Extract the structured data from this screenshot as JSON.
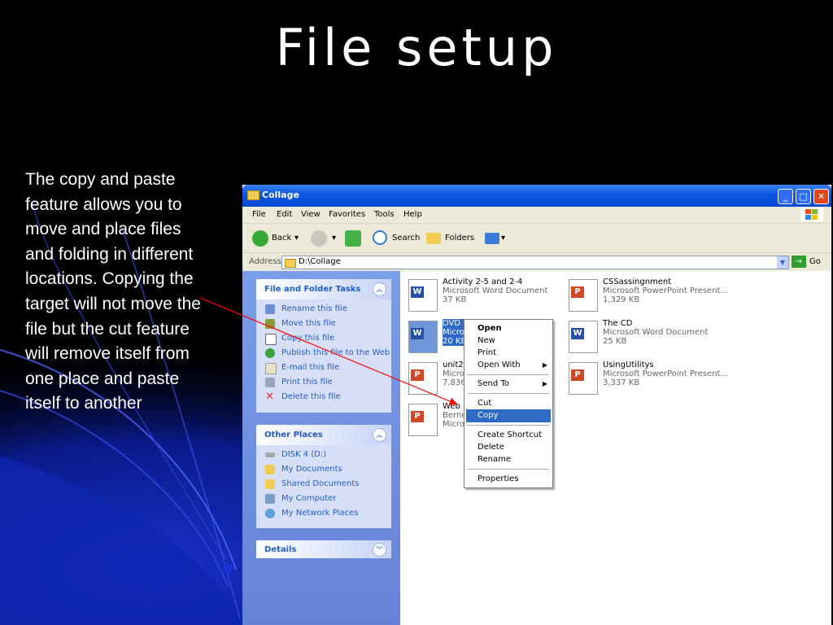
{
  "slide": {
    "title": "File setup",
    "body": "The copy and paste feature allows you to move and place files and folding in different locations. Copying the target will not move the file but the cut feature will remove itself from one place and paste itself to another"
  },
  "window": {
    "title": "Collage",
    "minimize": "_",
    "maximize": "□",
    "close": "✕"
  },
  "menu": [
    "File",
    "Edit",
    "View",
    "Favorites",
    "Tools",
    "Help"
  ],
  "toolbar": {
    "back": "Back",
    "back_drop": "▾",
    "fwd_drop": "▾",
    "search": "Search",
    "folders": "Folders",
    "views_drop": "▾"
  },
  "address": {
    "label": "Address",
    "value": "D:\\Collage",
    "go": "Go",
    "go_arrow": "→",
    "drop": "▼"
  },
  "tasks_panel": {
    "title": "File and Folder Tasks",
    "collapse": "︽",
    "items": [
      "Rename this file",
      "Move this file",
      "Copy this file",
      "Publish this file to the Web",
      "E-mail this file",
      "Print this file",
      "Delete this file"
    ]
  },
  "places_panel": {
    "title": "Other Places",
    "collapse": "︽",
    "items": [
      "DISK 4 (D:)",
      "My Documents",
      "Shared Documents",
      "My Computer",
      "My Network Places"
    ]
  },
  "details_panel": {
    "title": "Details",
    "collapse": "︾"
  },
  "files": [
    {
      "name": "Activity 2-5 and 2-4",
      "type": "Microsoft Word Document",
      "size": "37 KB",
      "kind": "W"
    },
    {
      "name": "CSSassingnment",
      "type": "Microsoft PowerPoint Present...",
      "size": "1,329 KB",
      "kind": "P"
    },
    {
      "name": "DVD t",
      "type": "Micro",
      "size": "20 KB",
      "kind": "W"
    },
    {
      "name": "The CD",
      "type": "Microsoft Word Document",
      "size": "25 KB",
      "kind": "W"
    },
    {
      "name": "unit2",
      "type": "Micros",
      "size": "7,836",
      "kind": "P"
    },
    {
      "name": "UsingUtilitys",
      "type": "Microsoft PowerPoint Present...",
      "size": "3,337 KB",
      "kind": "P"
    },
    {
      "name": "Web",
      "type": "Berne",
      "size": "Micros",
      "kind": "P"
    }
  ],
  "context_menu": {
    "items": [
      "Open",
      "New",
      "Print",
      "Open With",
      "Send To",
      "Cut",
      "Copy",
      "Create Shortcut",
      "Delete",
      "Rename",
      "Properties"
    ],
    "submenu_arrow": "▶",
    "active": "Copy"
  },
  "colors": {
    "background": "#000000",
    "xp_blue": "#0a55df",
    "task_link": "#215dc6",
    "selection": "#316ac5",
    "arrow": "#ff0000"
  }
}
